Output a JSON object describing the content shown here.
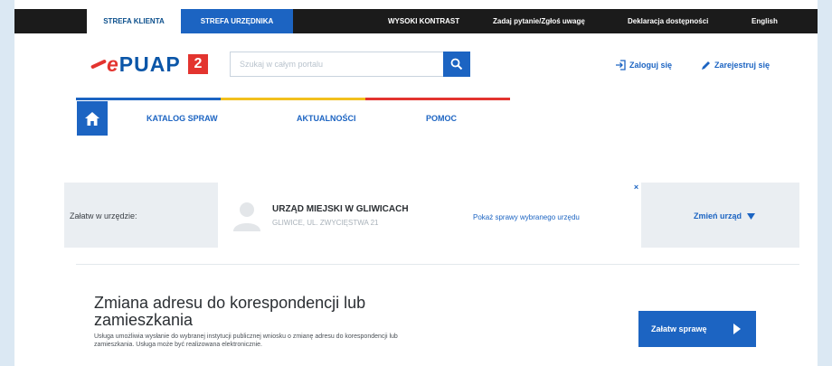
{
  "topbar": {
    "tabs": [
      {
        "label": "STREFA KLIENTA"
      },
      {
        "label": "STREFA URZĘDNIKA"
      }
    ],
    "links": [
      {
        "label": "WYSOKI KONTRAST"
      },
      {
        "label": "Zadaj pytanie/Zgłoś uwagę"
      },
      {
        "label": "Deklaracja dostępności"
      },
      {
        "label": "English"
      }
    ]
  },
  "header": {
    "logo_text": "PUAP",
    "logo_e": "e",
    "logo_badge": "2",
    "search_placeholder": "Szukaj w całym portalu",
    "login_label": "Zaloguj się",
    "register_label": "Zarejestruj się"
  },
  "nav": {
    "items": [
      {
        "label": "KATALOG SPRAW"
      },
      {
        "label": "AKTUALNOŚCI"
      },
      {
        "label": "POMOC"
      }
    ]
  },
  "office": {
    "label": "Załatw w urzędzie:",
    "name": "URZĄD MIEJSKI W GLIWICACH",
    "address": "GLIWICE, UL. ZWYCIĘSTWA 21",
    "show_services_link": "Pokaż sprawy wybranego urzędu",
    "close_symbol": "×",
    "change_label": "Zmień urząd"
  },
  "service": {
    "title": "Zmiana adresu do korespondencji lub zamieszkania",
    "description": "Usługa umożliwia wysłanie do wybranej instytucji publicznej wniosku o zmianę adresu do korespondencji lub zamieszkania. Usługa może być realizowana elektronicznie.",
    "cta_label": "Załatw sprawę"
  },
  "colors": {
    "brand_blue": "#1c64c2",
    "brand_red": "#e3342f",
    "topbar": "#1b1b1b",
    "accent_line": [
      "#1c64c2",
      "#f2c01e",
      "#e3342f"
    ]
  },
  "icons": [
    "search-icon",
    "login-icon",
    "pencil-icon",
    "home-icon",
    "user-avatar-icon",
    "triangle-down-icon",
    "play-arrow-icon"
  ]
}
